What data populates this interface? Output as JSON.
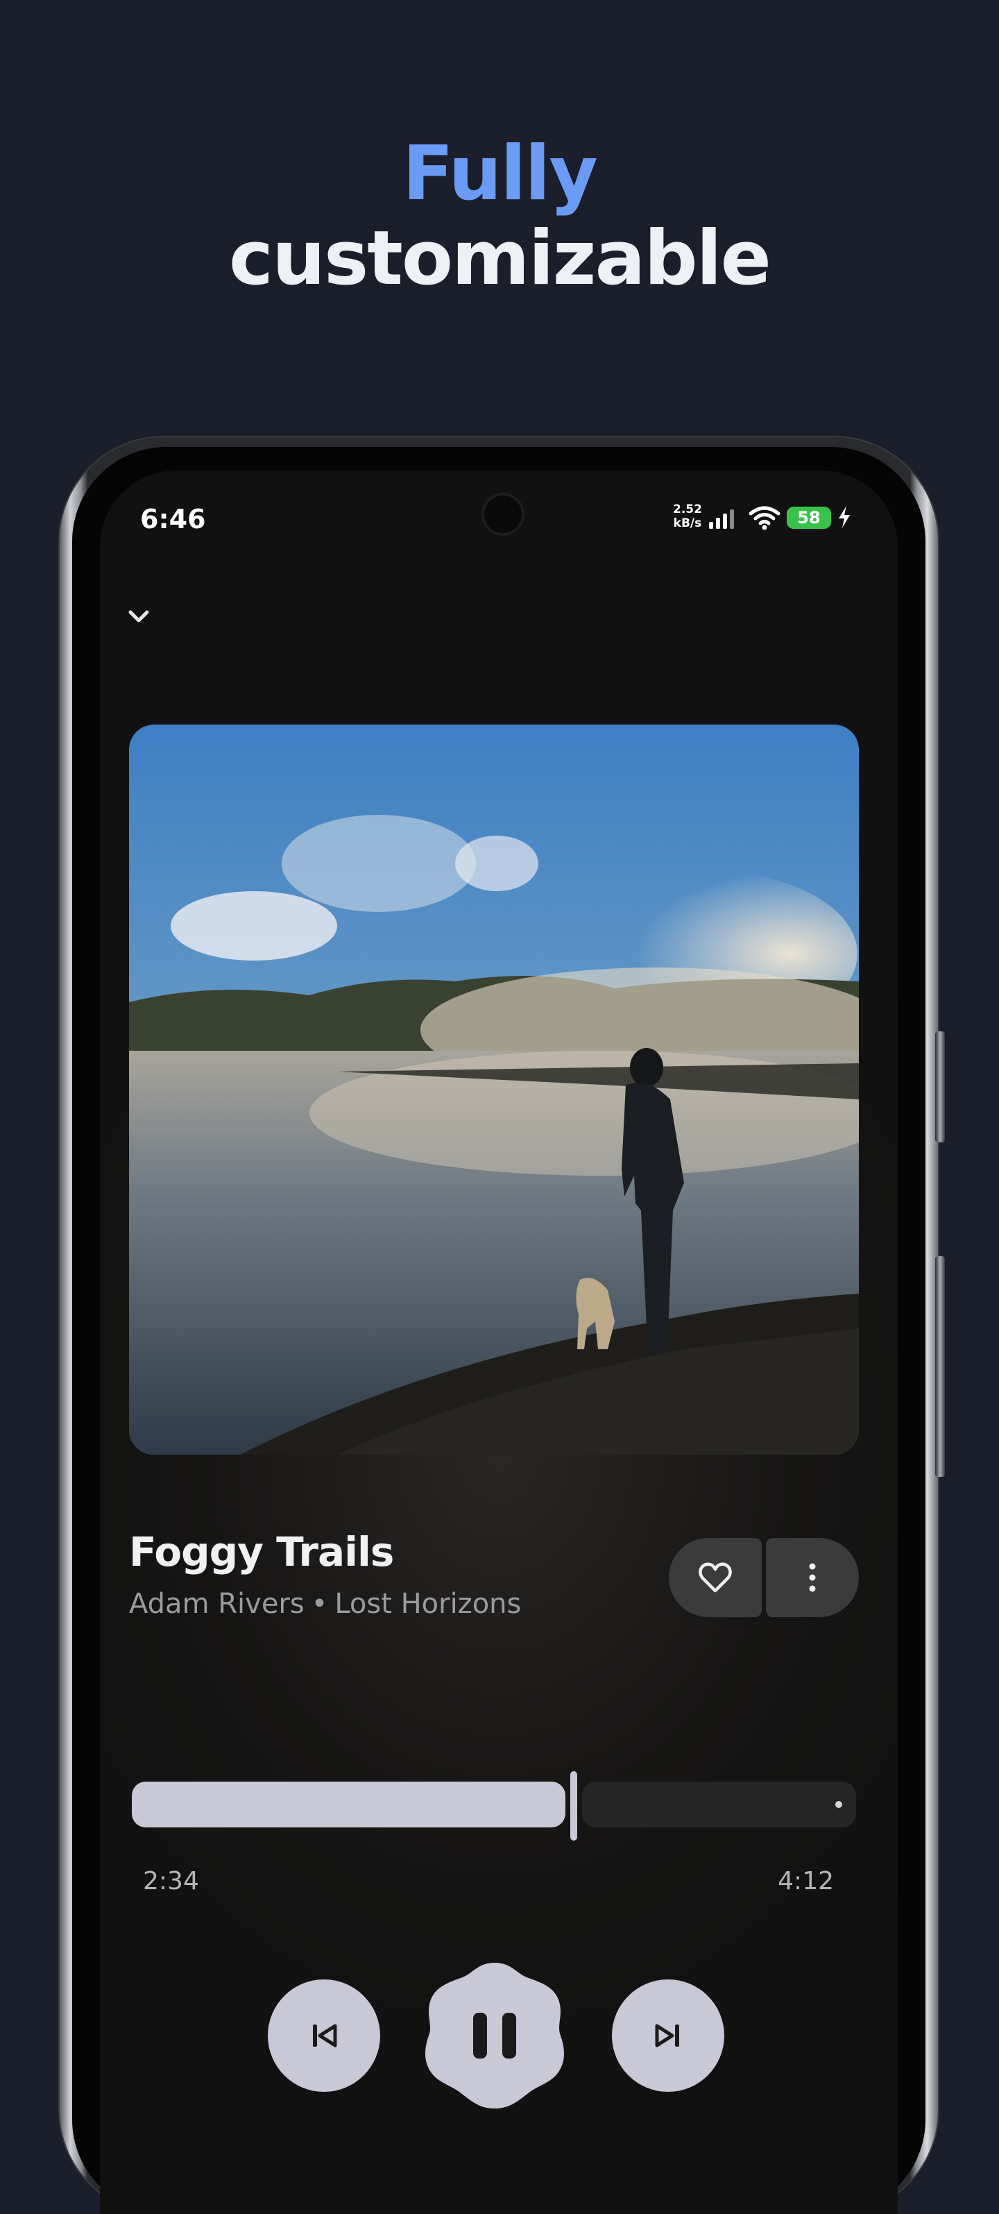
{
  "promo": {
    "headline_accent": "Fully",
    "headline_rest": "customizable"
  },
  "colors": {
    "background": "#1b1f2c",
    "accent": "#6b9bf5",
    "control": "#c9c8d6",
    "battery": "#39c24a"
  },
  "status_bar": {
    "time": "6:46",
    "net_speed_value": "2.52",
    "net_speed_unit": "kB/s",
    "battery_level": "58",
    "icons": [
      "signal-icon",
      "wifi-icon",
      "charging-bolt-icon"
    ]
  },
  "player": {
    "collapse_icon": "chevron-down-icon",
    "album_art_description": "misty lake at dawn with a man and a dog on the shore",
    "title": "Foggy Trails",
    "artist": "Adam Rivers",
    "separator": "•",
    "album": "Lost Horizons",
    "favorite_icon": "heart-outline-icon",
    "more_icon": "more-vertical-icon",
    "elapsed": "2:34",
    "duration": "4:12",
    "progress_fraction": 0.61,
    "controls": [
      "skip-previous-icon",
      "pause-icon",
      "skip-next-icon"
    ]
  }
}
